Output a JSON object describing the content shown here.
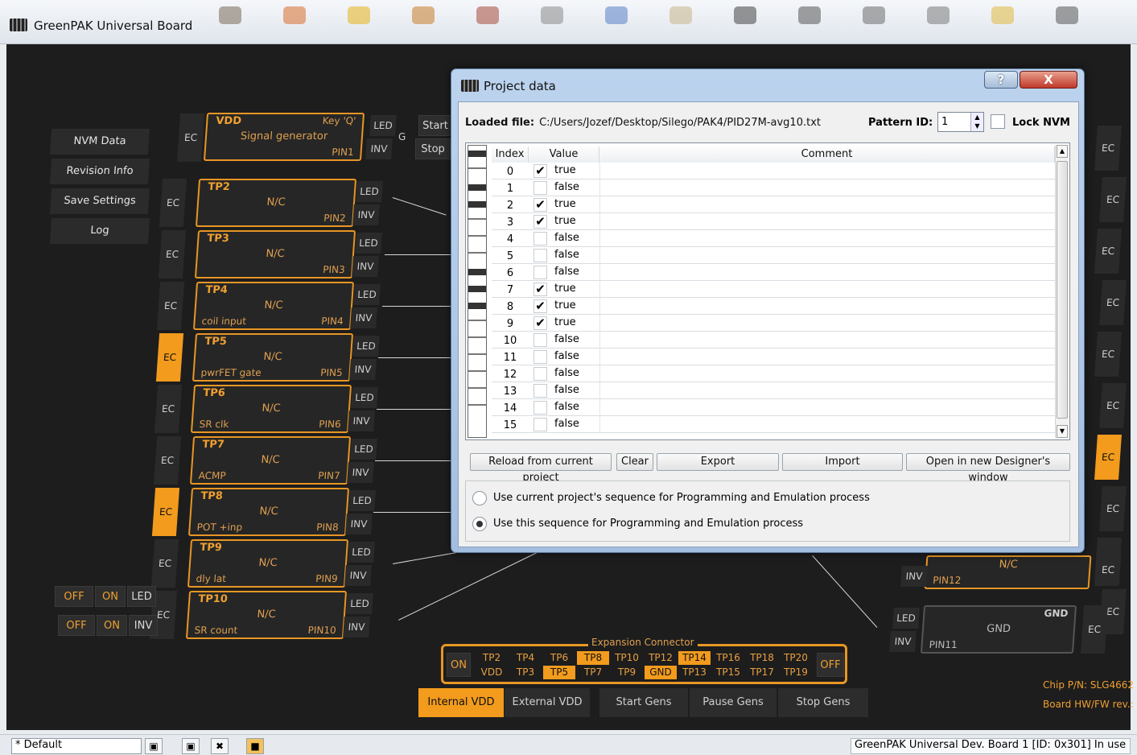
{
  "app": {
    "title": "GreenPAK Universal Board"
  },
  "toolbar_icons": [
    "chip-icon",
    "wand-icon",
    "tag-icon",
    "plug-icon",
    "bag-icon",
    "person-icon",
    "pencil-icon",
    "tool-icon",
    "wrench-icon",
    "board-icon",
    "card-icon",
    "note-icon",
    "coin-icon",
    "board-icon"
  ],
  "side_menu": [
    "NVM Data",
    "Revision Info",
    "Save Settings",
    "Log"
  ],
  "start_stop": {
    "start": "Start",
    "stop": "Stop"
  },
  "vdd": {
    "label": "VDD",
    "key": "Key 'Q'",
    "function": "Signal generator",
    "pin": "PIN1",
    "ec": "EC",
    "led": "LED",
    "inv": "INV",
    "g": "G"
  },
  "pins": [
    {
      "tp": "TP2",
      "fn": "N/C",
      "sub": "",
      "pin": "PIN2",
      "ec": "EC",
      "ec_on": false,
      "led": "LED",
      "inv": "INV"
    },
    {
      "tp": "TP3",
      "fn": "N/C",
      "sub": "",
      "pin": "PIN3",
      "ec": "EC",
      "ec_on": false,
      "led": "LED",
      "inv": "INV"
    },
    {
      "tp": "TP4",
      "fn": "N/C",
      "sub": "coil input",
      "pin": "PIN4",
      "ec": "EC",
      "ec_on": false,
      "led": "LED",
      "inv": "INV"
    },
    {
      "tp": "TP5",
      "fn": "N/C",
      "sub": "pwrFET gate",
      "pin": "PIN5",
      "ec": "EC",
      "ec_on": true,
      "led": "LED",
      "inv": "INV"
    },
    {
      "tp": "TP6",
      "fn": "N/C",
      "sub": "SR clk",
      "pin": "PIN6",
      "ec": "EC",
      "ec_on": false,
      "led": "LED",
      "inv": "INV"
    },
    {
      "tp": "TP7",
      "fn": "N/C",
      "sub": "ACMP",
      "pin": "PIN7",
      "ec": "EC",
      "ec_on": false,
      "led": "LED",
      "inv": "INV"
    },
    {
      "tp": "TP8",
      "fn": "N/C",
      "sub": "POT +inp",
      "pin": "PIN8",
      "ec": "EC",
      "ec_on": true,
      "led": "LED",
      "inv": "INV"
    },
    {
      "tp": "TP9",
      "fn": "N/C",
      "sub": "dly lat",
      "pin": "PIN9",
      "ec": "EC",
      "ec_on": false,
      "led": "LED",
      "inv": "INV"
    },
    {
      "tp": "TP10",
      "fn": "N/C",
      "sub": "SR count",
      "pin": "PIN10",
      "ec": "EC",
      "ec_on": false,
      "led": "LED",
      "inv": "INV"
    }
  ],
  "left_toggles": [
    {
      "off": "OFF",
      "on": "ON",
      "tag": "LED"
    },
    {
      "off": "OFF",
      "on": "ON",
      "tag": "INV"
    }
  ],
  "right_side": {
    "ec_labels": [
      "EC",
      "EC",
      "EC",
      "EC",
      "EC",
      "EC",
      "EC",
      "EC",
      "EC",
      "EC"
    ],
    "pin12": {
      "fn": "N/C",
      "pin": "PIN12",
      "inv": "INV",
      "ec": "EC"
    },
    "pin11": {
      "tp": "GND",
      "fn": "GND",
      "pin": "PIN11",
      "led": "LED",
      "inv": "INV",
      "ec": "EC"
    }
  },
  "expansion": {
    "caption": "Expansion Connector",
    "on": "ON",
    "off": "OFF",
    "top_row": [
      "TP2",
      "TP4",
      "TP6",
      "TP8",
      "TP10",
      "TP12",
      "TP14",
      "TP16",
      "TP18",
      "TP20"
    ],
    "bottom_row": [
      "VDD",
      "TP3",
      "TP5",
      "TP7",
      "TP9",
      "GND",
      "TP13",
      "TP15",
      "TP17",
      "TP19"
    ],
    "highlight_top": [
      "TP8",
      "TP14"
    ],
    "highlight_bottom": [
      "TP5",
      "GND"
    ]
  },
  "bottom_buttons": [
    "Internal VDD",
    "External VDD",
    "Start Gens",
    "Pause Gens",
    "Stop Gens"
  ],
  "chip_info": {
    "chip_pn": "Chip P/N: SLG4662",
    "board": "Board HW/FW rev.:"
  },
  "statusbar": {
    "profile": "* Default",
    "status": "GreenPAK Universal Dev. Board 1 [ID: 0x301] In use"
  },
  "dialog": {
    "title": "Project data",
    "help": "?",
    "close": "X",
    "loaded_label": "Loaded file:",
    "loaded_path": "C:/Users/Jozef/Desktop/Silego/PAK4/PID27M-avg10.txt",
    "pattern_label": "Pattern ID:",
    "pattern_value": "1",
    "lock_label": "Lock NVM",
    "columns": [
      "Index",
      "Value",
      "Comment"
    ],
    "rows": [
      {
        "index": "0",
        "checked": true,
        "value": "true"
      },
      {
        "index": "1",
        "checked": false,
        "value": "false"
      },
      {
        "index": "2",
        "checked": true,
        "value": "true"
      },
      {
        "index": "3",
        "checked": true,
        "value": "true"
      },
      {
        "index": "4",
        "checked": false,
        "value": "false"
      },
      {
        "index": "5",
        "checked": false,
        "value": "false"
      },
      {
        "index": "6",
        "checked": false,
        "value": "false"
      },
      {
        "index": "7",
        "checked": true,
        "value": "true"
      },
      {
        "index": "8",
        "checked": true,
        "value": "true"
      },
      {
        "index": "9",
        "checked": true,
        "value": "true"
      },
      {
        "index": "10",
        "checked": false,
        "value": "false"
      },
      {
        "index": "11",
        "checked": false,
        "value": "false"
      },
      {
        "index": "12",
        "checked": false,
        "value": "false"
      },
      {
        "index": "13",
        "checked": false,
        "value": "false"
      },
      {
        "index": "14",
        "checked": false,
        "value": "false"
      },
      {
        "index": "15",
        "checked": false,
        "value": "false"
      }
    ],
    "buttons": [
      "Reload from current project",
      "Clear",
      "Export",
      "Import",
      "Open in new Designer's window"
    ],
    "radio_current": "Use current project's sequence for Programming and Emulation process",
    "radio_this": "Use this sequence for Programming and Emulation process",
    "radio_selected": "this"
  },
  "colors": {
    "accent": "#f29b1d",
    "board_bg": "#1d1d1d",
    "dialog_frame": "#a3bedf"
  }
}
